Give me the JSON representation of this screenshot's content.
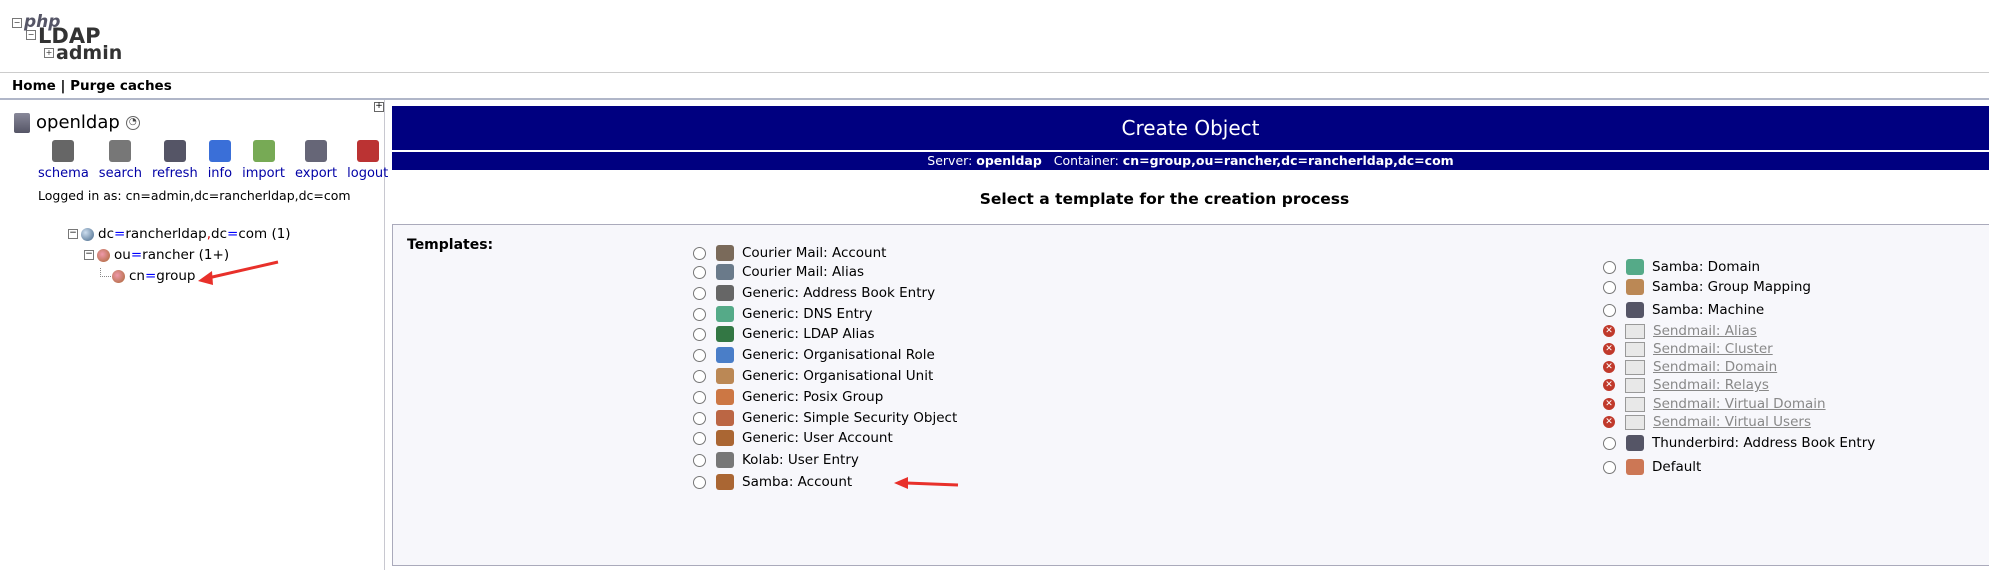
{
  "logo": {
    "php": "php",
    "ldap": "LDAP",
    "admin": "admin"
  },
  "menu": {
    "home": "Home",
    "sep": " | ",
    "purge": "Purge caches"
  },
  "server": {
    "name": "openldap"
  },
  "tools": [
    {
      "label": "schema",
      "icon": "schema-icon",
      "color": "#666"
    },
    {
      "label": "search",
      "icon": "search-icon",
      "color": "#777"
    },
    {
      "label": "refresh",
      "icon": "refresh-icon",
      "color": "#556"
    },
    {
      "label": "info",
      "icon": "info-icon",
      "color": "#3a6fd8"
    },
    {
      "label": "import",
      "icon": "import-icon",
      "color": "#7a5"
    },
    {
      "label": "export",
      "icon": "export-icon",
      "color": "#667"
    },
    {
      "label": "logout",
      "icon": "logout-icon",
      "color": "#b33"
    }
  ],
  "logged_in": "Logged in as: cn=admin,dc=rancherldap,dc=com",
  "tree": {
    "root": {
      "a": "dc",
      "b": "rancherldap",
      "c": "dc",
      "d": "com",
      "count": "(1)"
    },
    "ou": {
      "a": "ou",
      "b": "rancher",
      "count": "(1+)"
    },
    "cn": {
      "a": "cn",
      "b": "group"
    }
  },
  "header": {
    "title": "Create Object",
    "server_label": "Server:",
    "server": "openldap",
    "container_label": "Container:",
    "container": "cn=group,ou=rancher,dc=rancherldap,dc=com"
  },
  "select_title": "Select a template for the creation process",
  "templates_label": "Templates:",
  "templates_left": [
    {
      "label": "Courier Mail: Account",
      "icon": "courier-account-icon"
    },
    {
      "label": "Courier Mail: Alias",
      "icon": "courier-alias-icon"
    },
    {
      "label": "Generic: Address Book Entry",
      "icon": "address-book-icon"
    },
    {
      "label": "Generic: DNS Entry",
      "icon": "dns-icon"
    },
    {
      "label": "Generic: LDAP Alias",
      "icon": "ldap-alias-icon"
    },
    {
      "label": "Generic: Organisational Role",
      "icon": "org-role-icon"
    },
    {
      "label": "Generic: Organisational Unit",
      "icon": "org-unit-icon"
    },
    {
      "label": "Generic: Posix Group",
      "icon": "posix-group-icon"
    },
    {
      "label": "Generic: Simple Security Object",
      "icon": "security-object-icon"
    },
    {
      "label": "Generic: User Account",
      "icon": "user-account-icon"
    },
    {
      "label": "Kolab: User Entry",
      "icon": "kolab-user-icon"
    },
    {
      "label": "Samba: Account",
      "icon": "samba-account-icon"
    }
  ],
  "templates_right": [
    {
      "label": "Samba: Domain",
      "icon": "samba-domain-icon",
      "disabled": false
    },
    {
      "label": "Samba: Group Mapping",
      "icon": "samba-group-icon",
      "disabled": false
    },
    {
      "label": "Samba: Machine",
      "icon": "samba-machine-icon",
      "disabled": false
    },
    {
      "label": "Sendmail: Alias",
      "icon": "sendmail-icon",
      "disabled": true
    },
    {
      "label": "Sendmail: Cluster",
      "icon": "sendmail-icon",
      "disabled": true
    },
    {
      "label": "Sendmail: Domain",
      "icon": "sendmail-icon",
      "disabled": true
    },
    {
      "label": "Sendmail: Relays",
      "icon": "sendmail-icon",
      "disabled": true
    },
    {
      "label": "Sendmail: Virtual Domain",
      "icon": "sendmail-icon",
      "disabled": true
    },
    {
      "label": "Sendmail: Virtual Users",
      "icon": "sendmail-icon",
      "disabled": true
    },
    {
      "label": "Thunderbird: Address Book Entry",
      "icon": "thunderbird-icon",
      "disabled": false
    },
    {
      "label": "Default",
      "icon": "default-icon",
      "disabled": false
    }
  ],
  "colors": {
    "header_bg": "#000080",
    "link": "#0000a6",
    "disabled": "#888888",
    "annotation": "#e8302a"
  }
}
